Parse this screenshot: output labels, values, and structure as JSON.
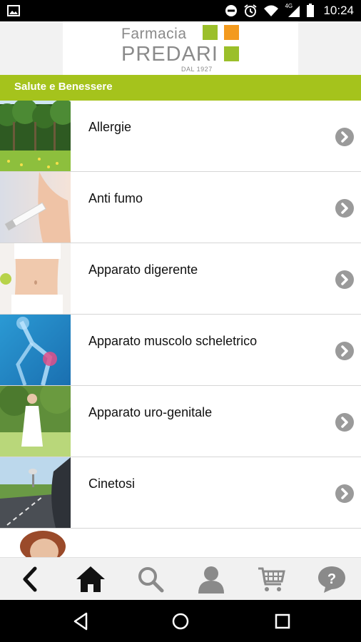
{
  "status_bar": {
    "time": "10:24",
    "network": "4G",
    "icons": [
      "image-icon",
      "do-not-disturb-icon",
      "alarm-icon",
      "wifi-icon",
      "signal-icon",
      "battery-icon"
    ]
  },
  "header": {
    "logo_line1": "Farmacia",
    "logo_line2": "PREDARI",
    "logo_line3": "DAL 1927",
    "logo_colors": [
      "#9bbf2a",
      "#f39a1e",
      "#9bbf2a"
    ]
  },
  "section": {
    "title": "Salute e Benessere",
    "color": "#a5c31c"
  },
  "items": [
    {
      "label": "Allergie",
      "icon": "trees-meadow-thumbnail"
    },
    {
      "label": "Anti fumo",
      "icon": "cigarette-thumbnail"
    },
    {
      "label": "Apparato digerente",
      "icon": "abdomen-thumbnail"
    },
    {
      "label": "Apparato muscolo scheletrico",
      "icon": "skeleton-knee-thumbnail"
    },
    {
      "label": "Apparato uro-genitale",
      "icon": "woman-meadow-thumbnail"
    },
    {
      "label": "Cinetosi",
      "icon": "road-car-thumbnail"
    },
    {
      "label": "",
      "icon": "portrait-thumbnail"
    }
  ],
  "toolbar": {
    "buttons": [
      "back-icon",
      "home-icon",
      "search-icon",
      "user-icon",
      "cart-icon",
      "help-icon"
    ]
  },
  "navigation": {
    "buttons": [
      "nav-back-icon",
      "nav-home-icon",
      "nav-recents-icon"
    ]
  }
}
